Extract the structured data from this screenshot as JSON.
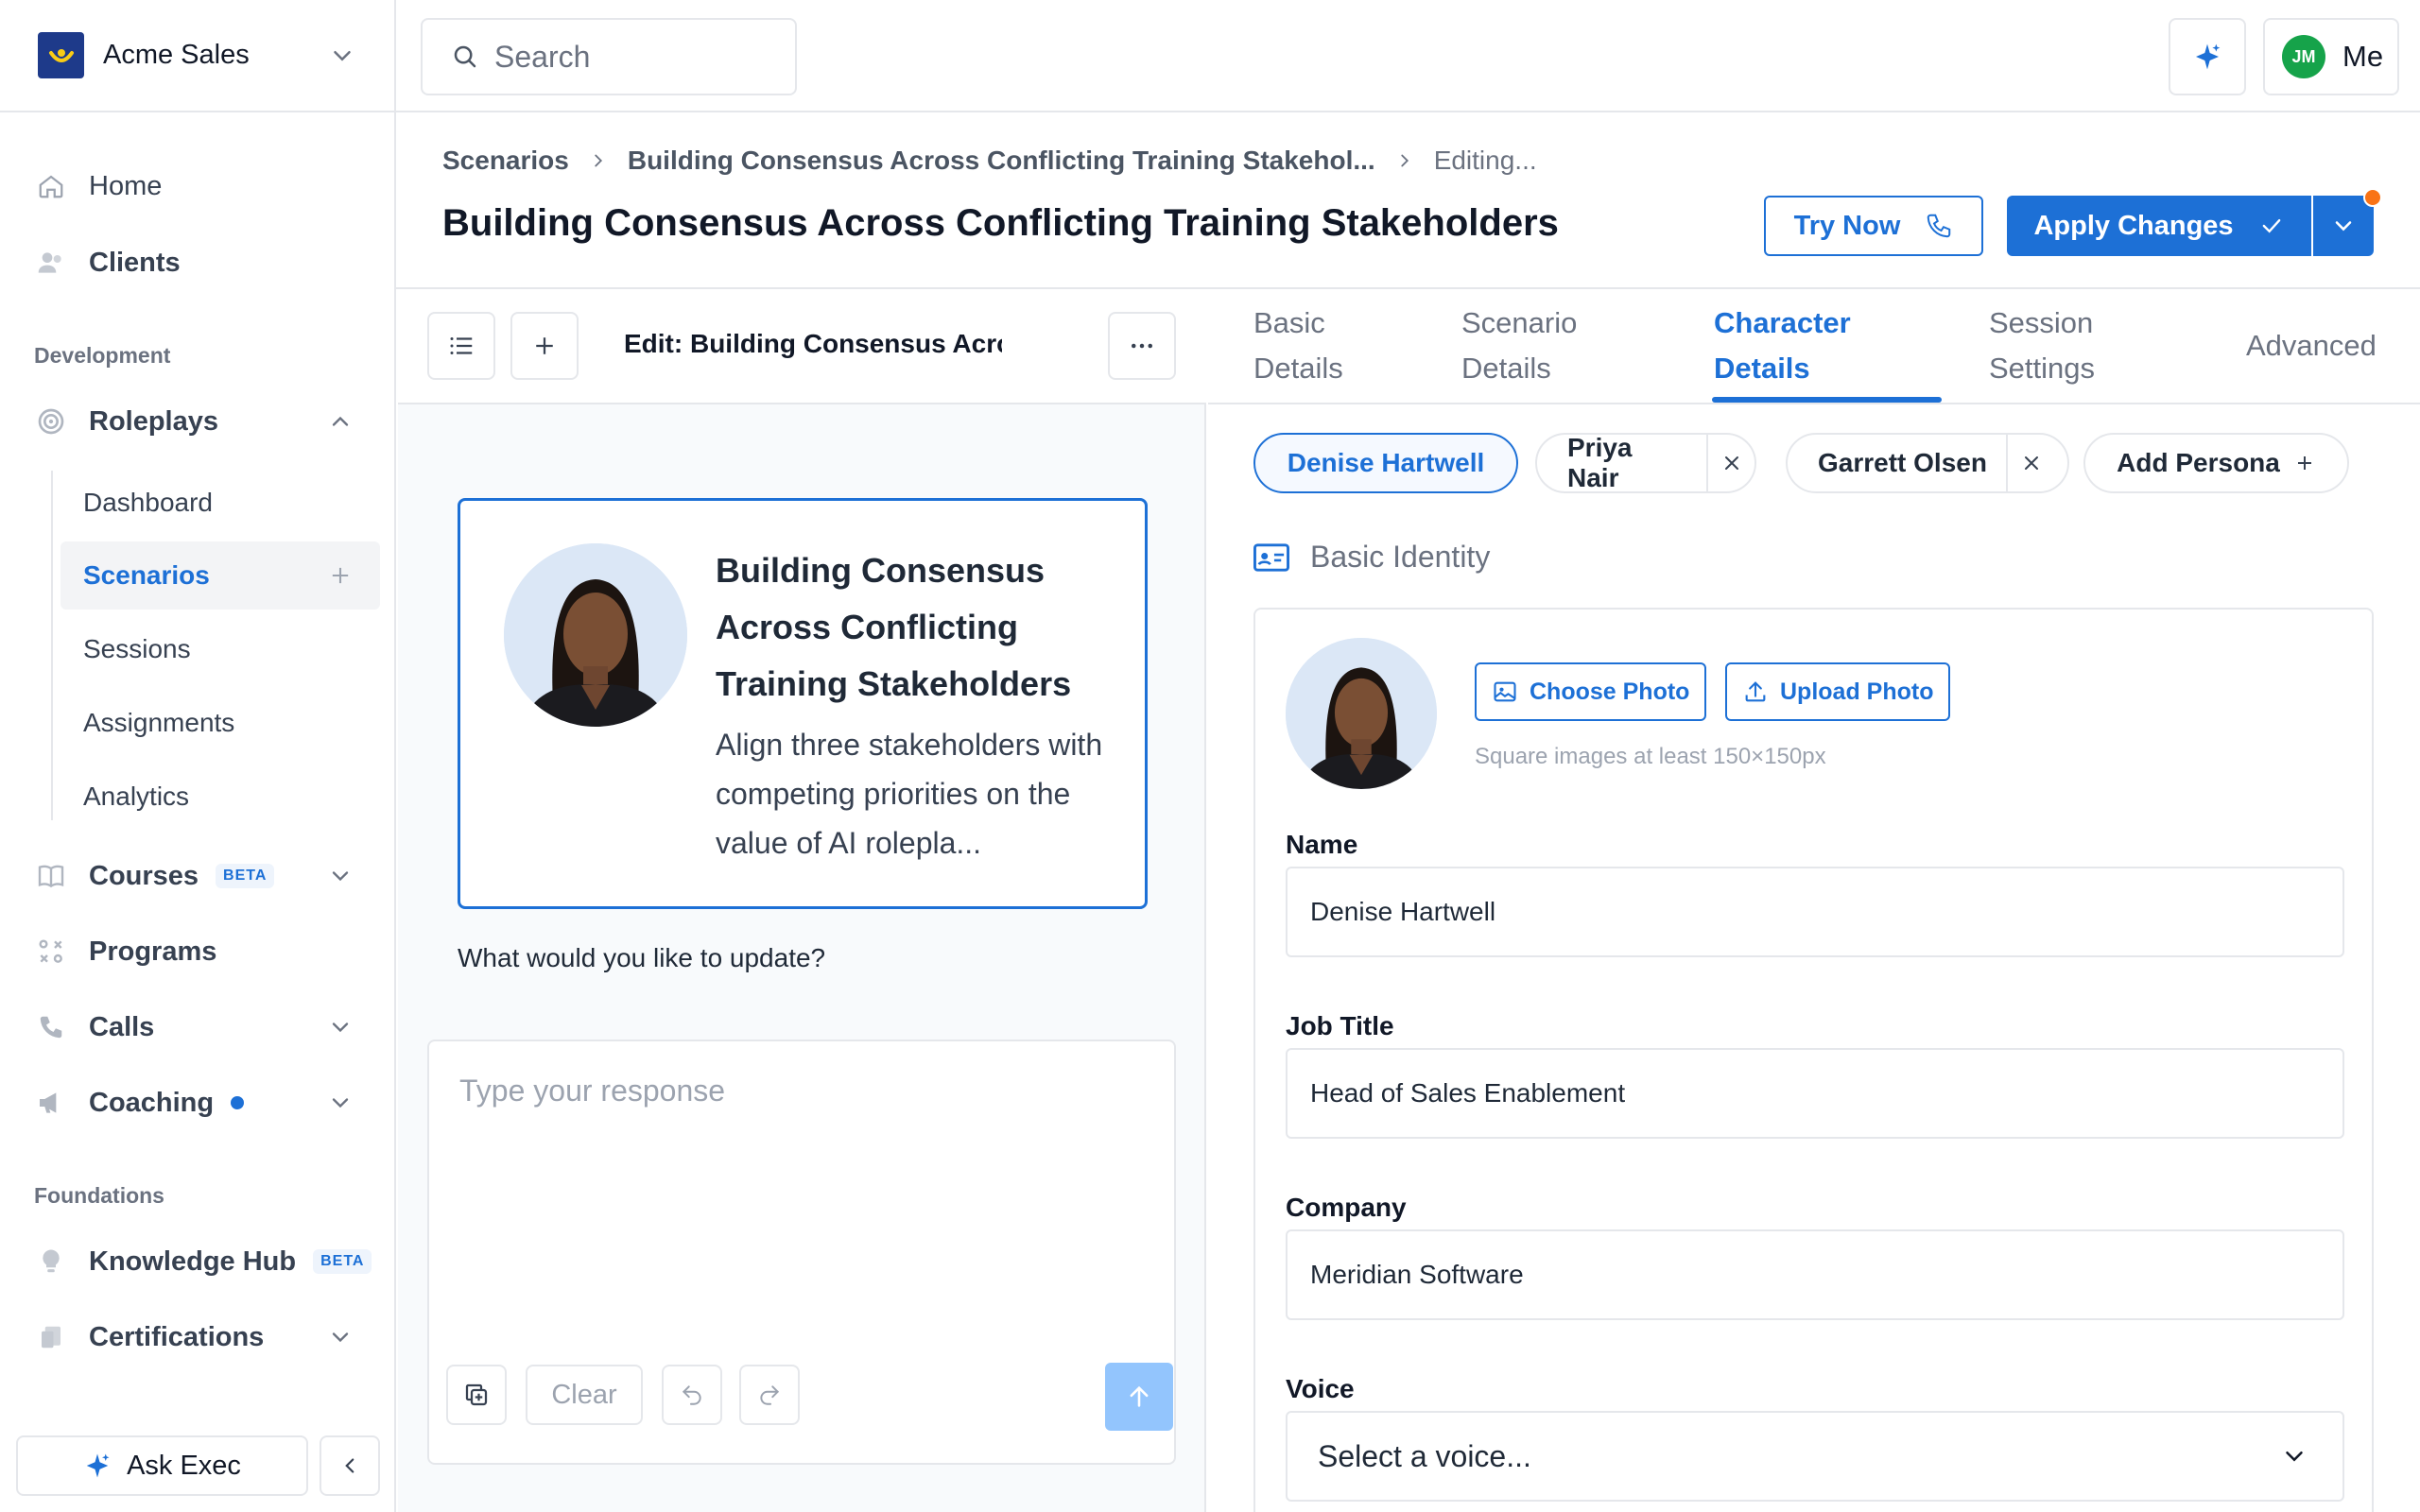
{
  "org": {
    "name": "Acme Sales"
  },
  "search": {
    "placeholder": "Search"
  },
  "user": {
    "initials": "JM",
    "label": "Me"
  },
  "colors": {
    "accent": "#1d70d6",
    "brand_logo": "#1e3a8a",
    "avatar": "#16a34a",
    "notification": "#f97316"
  },
  "sidebar": {
    "items": [
      {
        "label": "Home",
        "icon": "home-icon"
      },
      {
        "label": "Clients",
        "icon": "clients-icon"
      }
    ],
    "development_label": "Development",
    "roleplays": {
      "label": "Roleplays",
      "icon": "target-icon"
    },
    "roleplays_sub": [
      "Dashboard",
      "Scenarios",
      "Sessions",
      "Assignments",
      "Analytics"
    ],
    "courses": {
      "label": "Courses",
      "badge": "BETA",
      "icon": "book-icon"
    },
    "programs": {
      "label": "Programs",
      "icon": "programs-icon"
    },
    "calls": {
      "label": "Calls",
      "icon": "phone-icon"
    },
    "coaching": {
      "label": "Coaching",
      "icon": "megaphone-icon"
    },
    "foundations_label": "Foundations",
    "knowledge": {
      "label": "Knowledge Hub",
      "badge": "BETA",
      "icon": "lightbulb-icon"
    },
    "certifications": {
      "label": "Certifications",
      "icon": "certificate-icon"
    },
    "ask_exec": "Ask Exec"
  },
  "breadcrumb": {
    "root": "Scenarios",
    "parent": "Building Consensus Across Conflicting Training Stakehol...",
    "current": "Editing..."
  },
  "page": {
    "title": "Building Consensus Across Conflicting Training Stakeholders"
  },
  "actions": {
    "try_now": "Try Now",
    "apply": "Apply Changes"
  },
  "editor": {
    "title": "Edit: Building Consensus Across Co",
    "card_title": "Building Consensus Across Conflicting Training Stakeholders",
    "card_desc": "Align three stakeholders with competing priorities on the value of AI rolepla...",
    "question": "What would you like to update?",
    "composer_placeholder": "Type your response",
    "clear": "Clear"
  },
  "tabs": [
    {
      "line1": "Basic",
      "line2": "Details"
    },
    {
      "line1": "Scenario",
      "line2": "Details"
    },
    {
      "line1": "Character",
      "line2": "Details"
    },
    {
      "line1": "Session",
      "line2": "Settings"
    },
    {
      "line1": "Advanced",
      "line2": ""
    }
  ],
  "personas": [
    "Denise Hartwell",
    "Priya Nair",
    "Garrett Olsen"
  ],
  "add_persona": "Add Persona",
  "identity": {
    "section_title": "Basic Identity",
    "choose_photo": "Choose Photo",
    "upload_photo": "Upload Photo",
    "photo_hint": "Square images at least 150×150px",
    "name_label": "Name",
    "name_value": "Denise Hartwell",
    "job_label": "Job Title",
    "job_value": "Head of Sales Enablement",
    "company_label": "Company",
    "company_value": "Meridian Software",
    "voice_label": "Voice",
    "voice_placeholder": "Select a voice..."
  }
}
